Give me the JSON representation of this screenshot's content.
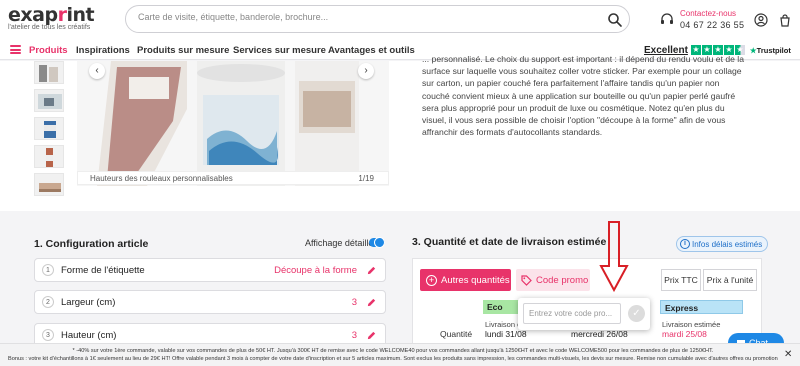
{
  "colors": {
    "accent": "#e8336a",
    "blue": "#1e88e5",
    "eco": "#a8e6a3",
    "express": "#b9e3f7",
    "trustpilot": "#00b67a"
  },
  "header": {
    "logo_text_1": "exap",
    "logo_text_dot": "r",
    "logo_text_2": "int",
    "logo_tagline": "l'atelier de tous les créatifs",
    "search_placeholder": "Carte de visite, étiquette, banderole, brochure...",
    "contact_label": "Contactez-nous",
    "contact_phone": "04 67 22 36 55",
    "icons": [
      "search-icon",
      "headset-icon",
      "user-icon",
      "cart-icon"
    ]
  },
  "nav": {
    "items": [
      "Produits",
      "Inspirations",
      "Produits sur mesure",
      "Services sur mesure",
      "Avantages et outils"
    ],
    "trustpilot_label": "Excellent",
    "trustpilot_rating_stars": 4.5,
    "trustpilot_brand": "Trustpilot"
  },
  "gallery": {
    "caption": "Hauteurs des rouleaux personnalisables",
    "counter": "1/19"
  },
  "description": "... personnalisé. Le choix du support est important : il dépend du rendu voulu et de la surface sur laquelle vous souhaitez coller votre sticker. Par exemple pour un collage sur carton, un papier couché fera parfaitement l'affaire tandis qu'un papier non couché convient mieux à une application sur bouteille ou qu'un papier perlé gaufré sera plus approprié pour un produit de luxe ou cosmétique. Notez qu'en plus du visuel, il vous sera possible de choisir l'option \"découpe à la forme\" afin de vous affranchir des formats d'autocollants standards.",
  "config": {
    "title": "1. Configuration article",
    "detail_toggle_label": "Affichage détaillé",
    "rows": [
      {
        "num": "1",
        "label": "Forme de l'étiquette",
        "value": "Découpe à la forme"
      },
      {
        "num": "2",
        "label": "Largeur (cm)",
        "value": "3"
      },
      {
        "num": "3",
        "label": "Hauteur (cm)",
        "value": "3"
      }
    ]
  },
  "quantity": {
    "title": "3. Quantité et date de livraison estimée",
    "info_badge": "Infos délais estimés",
    "more_qty_button": "Autres quantités",
    "promo_button": "Code promo",
    "price_ttc": "Prix TTC",
    "unit_price": "Prix à l'unité",
    "row_label": "Quantité",
    "promo_placeholder": "Entrez votre code pro...",
    "columns": [
      {
        "name": "Eco",
        "sub": "Livraison e",
        "date": "lundi 31/08"
      },
      {
        "name": "",
        "sub": "",
        "date": "mercredi 26/08"
      },
      {
        "name": "Express",
        "sub": "Livraison estimée",
        "date": "mardi 25/08"
      }
    ]
  },
  "chat_label": "Chat",
  "banner": {
    "line1": "* -40% sur votre 1ère commande, valable sur vos commandes de plus de 50€ HT. Jusqu'à 300€ HT de remise avec le code WELCOME40 pour vos commandes allant jusqu'à 1250€HT et avec le code WELCOME500 pour les commandes de plus de 1250€HT.",
    "line2": "Bonus : votre kit d'échantillons à 1€ seulement au lieu de 29€ HT! Offre valable pendant 3 mois à compter de votre date d'inscription et sur 5 articles maximum. Sont exclus les produits sans impression, les commandes multi-visuels, les devis sur mesure. Remise non cumulable avec d'autres offres ou promotions."
  }
}
